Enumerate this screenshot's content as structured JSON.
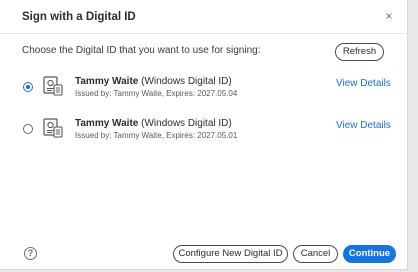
{
  "dialog": {
    "title": "Sign with a Digital ID",
    "close_label": "×",
    "prompt": "Choose the Digital ID that you want to use for signing:",
    "refresh_label": "Refresh",
    "accent_color": "#1473e6"
  },
  "ids": [
    {
      "selected": true,
      "name": "Tammy Waite",
      "type": " (Windows Digital ID)",
      "issued": "Issued by: Tammy Waite, Expires: 2027.05.04",
      "view_details": "View Details",
      "icon": "certificate-icon"
    },
    {
      "selected": false,
      "name": "Tammy Waite",
      "type": " (Windows Digital ID)",
      "issued": "Issued by: Tammy Waite, Expires: 2027.05.01",
      "view_details": "View Details",
      "icon": "certificate-icon"
    }
  ],
  "footer": {
    "help_label": "?",
    "configure_label": "Configure New Digital ID",
    "cancel_label": "Cancel",
    "continue_label": "Continue"
  }
}
